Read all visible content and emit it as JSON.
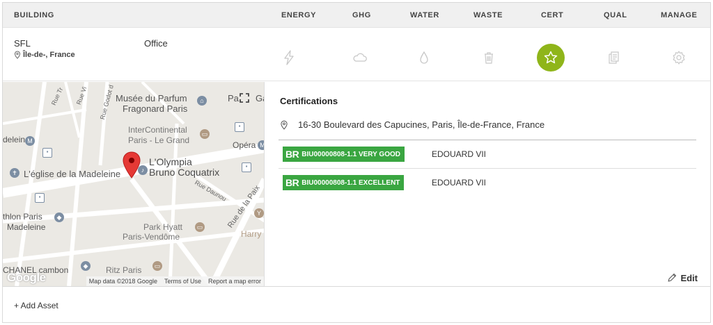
{
  "header": {
    "building": "BUILDING",
    "energy": "ENERGY",
    "ghg": "GHG",
    "water": "WATER",
    "waste": "WASTE",
    "cert": "CERT",
    "qual": "QUAL",
    "manage": "MANAGE"
  },
  "building": {
    "name": "SFL",
    "location": "Île-de-, France",
    "type": "Office"
  },
  "categories": [
    {
      "key": "energy",
      "icon": "lightning-icon",
      "active": false
    },
    {
      "key": "ghg",
      "icon": "cloud-icon",
      "active": false
    },
    {
      "key": "water",
      "icon": "water-drop-icon",
      "active": false
    },
    {
      "key": "waste",
      "icon": "trash-icon",
      "active": false
    },
    {
      "key": "cert",
      "icon": "star-icon",
      "active": true
    },
    {
      "key": "qual",
      "icon": "documents-icon",
      "active": false
    },
    {
      "key": "manage",
      "icon": "gear-icon",
      "active": false
    }
  ],
  "colors": {
    "accent": "#8fb51a",
    "badge": "#3aa641",
    "header_bg": "#f0f0f0",
    "marker": "#e53935"
  },
  "map": {
    "labels": {
      "musee": "Musée du Parfum",
      "fragonard": "Fragonard Paris",
      "intercontinental": "InterContinental",
      "parislegrand": "Paris - Le Grand",
      "madeleine": "deleine",
      "opera": "Opéra",
      "eglise": "L'église de la Madeleine",
      "olympia": "L'Olympia",
      "coquatrix": "Bruno Coquatrix",
      "daunou": "Rue Daunou",
      "delapaix": "Rue de la Paix",
      "athlon": "thlon Paris",
      "madeleine2": "Madeleine",
      "parkhyatt": "Park Hyatt",
      "vendome": "Paris-Vendôme",
      "harry": "Harry",
      "chanel": "CHANEL cambon",
      "ritz": "Ritz Paris",
      "pa": "Pa",
      "ga": "Ga",
      "ruetr": "Rue Tr",
      "ruevi": "Rue Vi",
      "ruegodot": "Rue Godot d"
    },
    "google": "Google",
    "map_data": "Map data ©2018 Google",
    "terms": "Terms of Use",
    "report": "Report a map error"
  },
  "certifications": {
    "title": "Certifications",
    "address": "16-30 Boulevard des Capucines, Paris, Île-de-France, France",
    "items": [
      {
        "prefix": "BR",
        "code": "BIU00000808-1.1 VERY GOOD",
        "name": "EDOUARD VII"
      },
      {
        "prefix": "BR",
        "code": "BIU00000808-1.1 EXCELLENT",
        "name": "EDOUARD VII"
      }
    ],
    "edit": "Edit"
  },
  "add_asset": "+ Add Asset"
}
